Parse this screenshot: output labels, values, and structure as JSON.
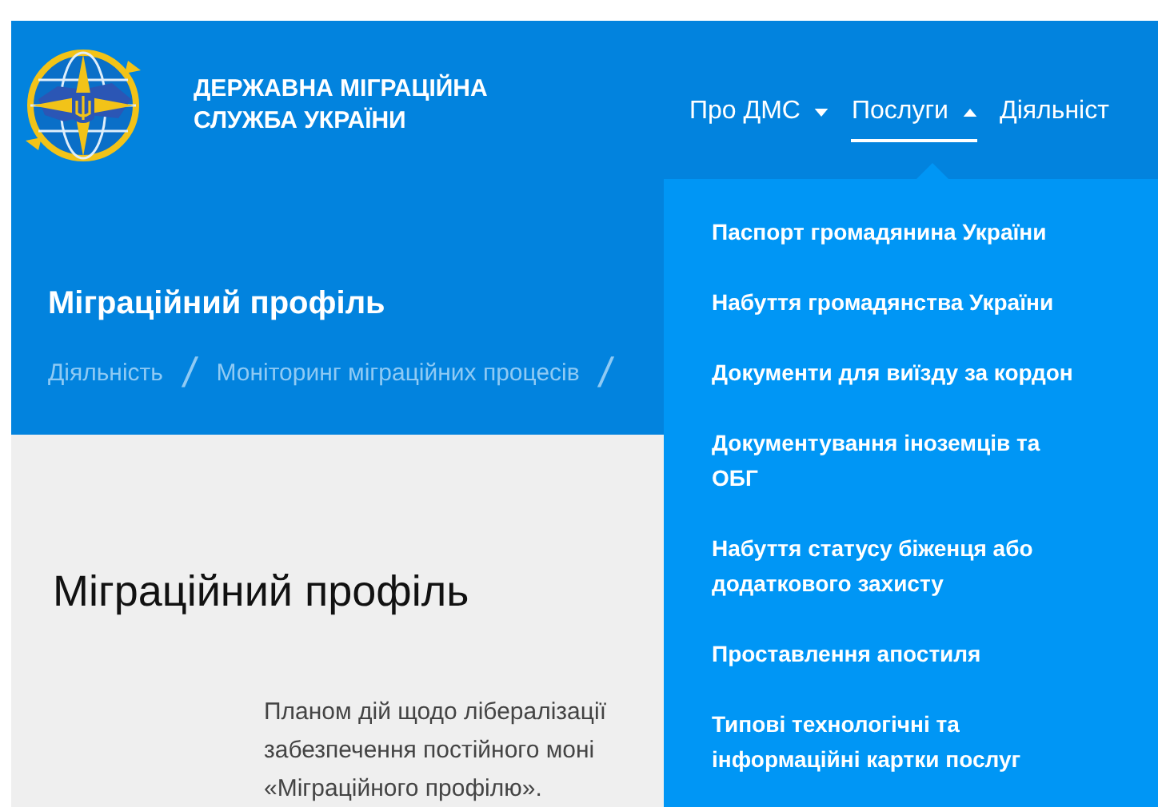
{
  "header": {
    "org_name": [
      "ДЕРЖАВНА МІГРАЦІЙНА",
      "СЛУЖБА УКРАЇНИ"
    ],
    "nav": [
      {
        "label": "Про ДМС",
        "kind": "dropdown",
        "selected": false,
        "expanded": false
      },
      {
        "label": "Послуги",
        "kind": "dropdown",
        "selected": true,
        "expanded": true
      },
      {
        "label": "Діяльніст",
        "kind": "link",
        "selected": false
      }
    ]
  },
  "banner": {
    "title": "Міграційний профіль",
    "breadcrumbs": [
      {
        "kind": "link",
        "text": "Діяльність"
      },
      {
        "kind": "separator",
        "text": "/"
      },
      {
        "kind": "link",
        "text": "Моніторинг міграційних процесів"
      },
      {
        "kind": "separator",
        "text": "/"
      }
    ]
  },
  "dropdown": {
    "items": [
      "Паспорт громадянина України",
      "Набуття громадянства України",
      "Документи для виїзду за кордон",
      "Документування іноземців та ОБГ",
      "Набуття статусу біженця або додаткового захисту",
      "Проставлення апостиля",
      "Типові технологічні та інформаційні картки послуг"
    ]
  },
  "content": {
    "heading": "Міграційний профіль",
    "paragraph_lines": [
      "Планом дій щодо лібералізації",
      "забезпечення постійного моні",
      "«Міграційного профілю»."
    ]
  }
}
